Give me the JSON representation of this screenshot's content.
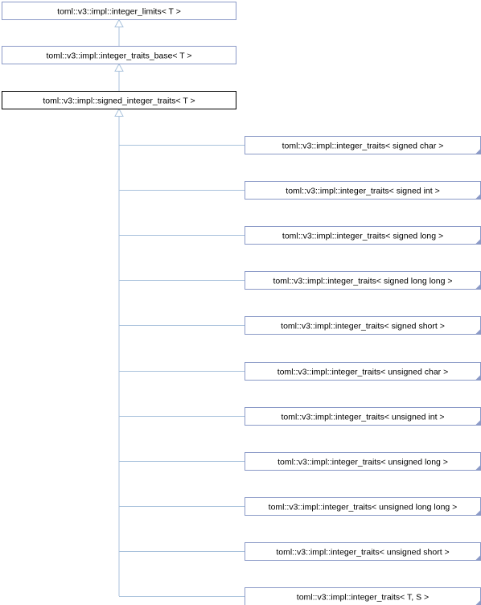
{
  "colors": {
    "node_fill": "#ffffff",
    "node_border": "#8b9ac7",
    "focus_border": "#000000",
    "edge": "#a9c2dc",
    "corner_marker": "#8b9ac7"
  },
  "ancestors": [
    "toml::v3::impl::integer_limits< T >",
    "toml::v3::impl::integer_traits_base< T >"
  ],
  "focus": "toml::v3::impl::signed_integer_traits< T >",
  "children": [
    "toml::v3::impl::integer_traits< signed char >",
    "toml::v3::impl::integer_traits< signed int >",
    "toml::v3::impl::integer_traits< signed long >",
    "toml::v3::impl::integer_traits< signed long long >",
    "toml::v3::impl::integer_traits< signed short >",
    "toml::v3::impl::integer_traits< unsigned char >",
    "toml::v3::impl::integer_traits< unsigned int >",
    "toml::v3::impl::integer_traits< unsigned long >",
    "toml::v3::impl::integer_traits< unsigned long long >",
    "toml::v3::impl::integer_traits< unsigned short >",
    "toml::v3::impl::integer_traits< T, S >"
  ]
}
